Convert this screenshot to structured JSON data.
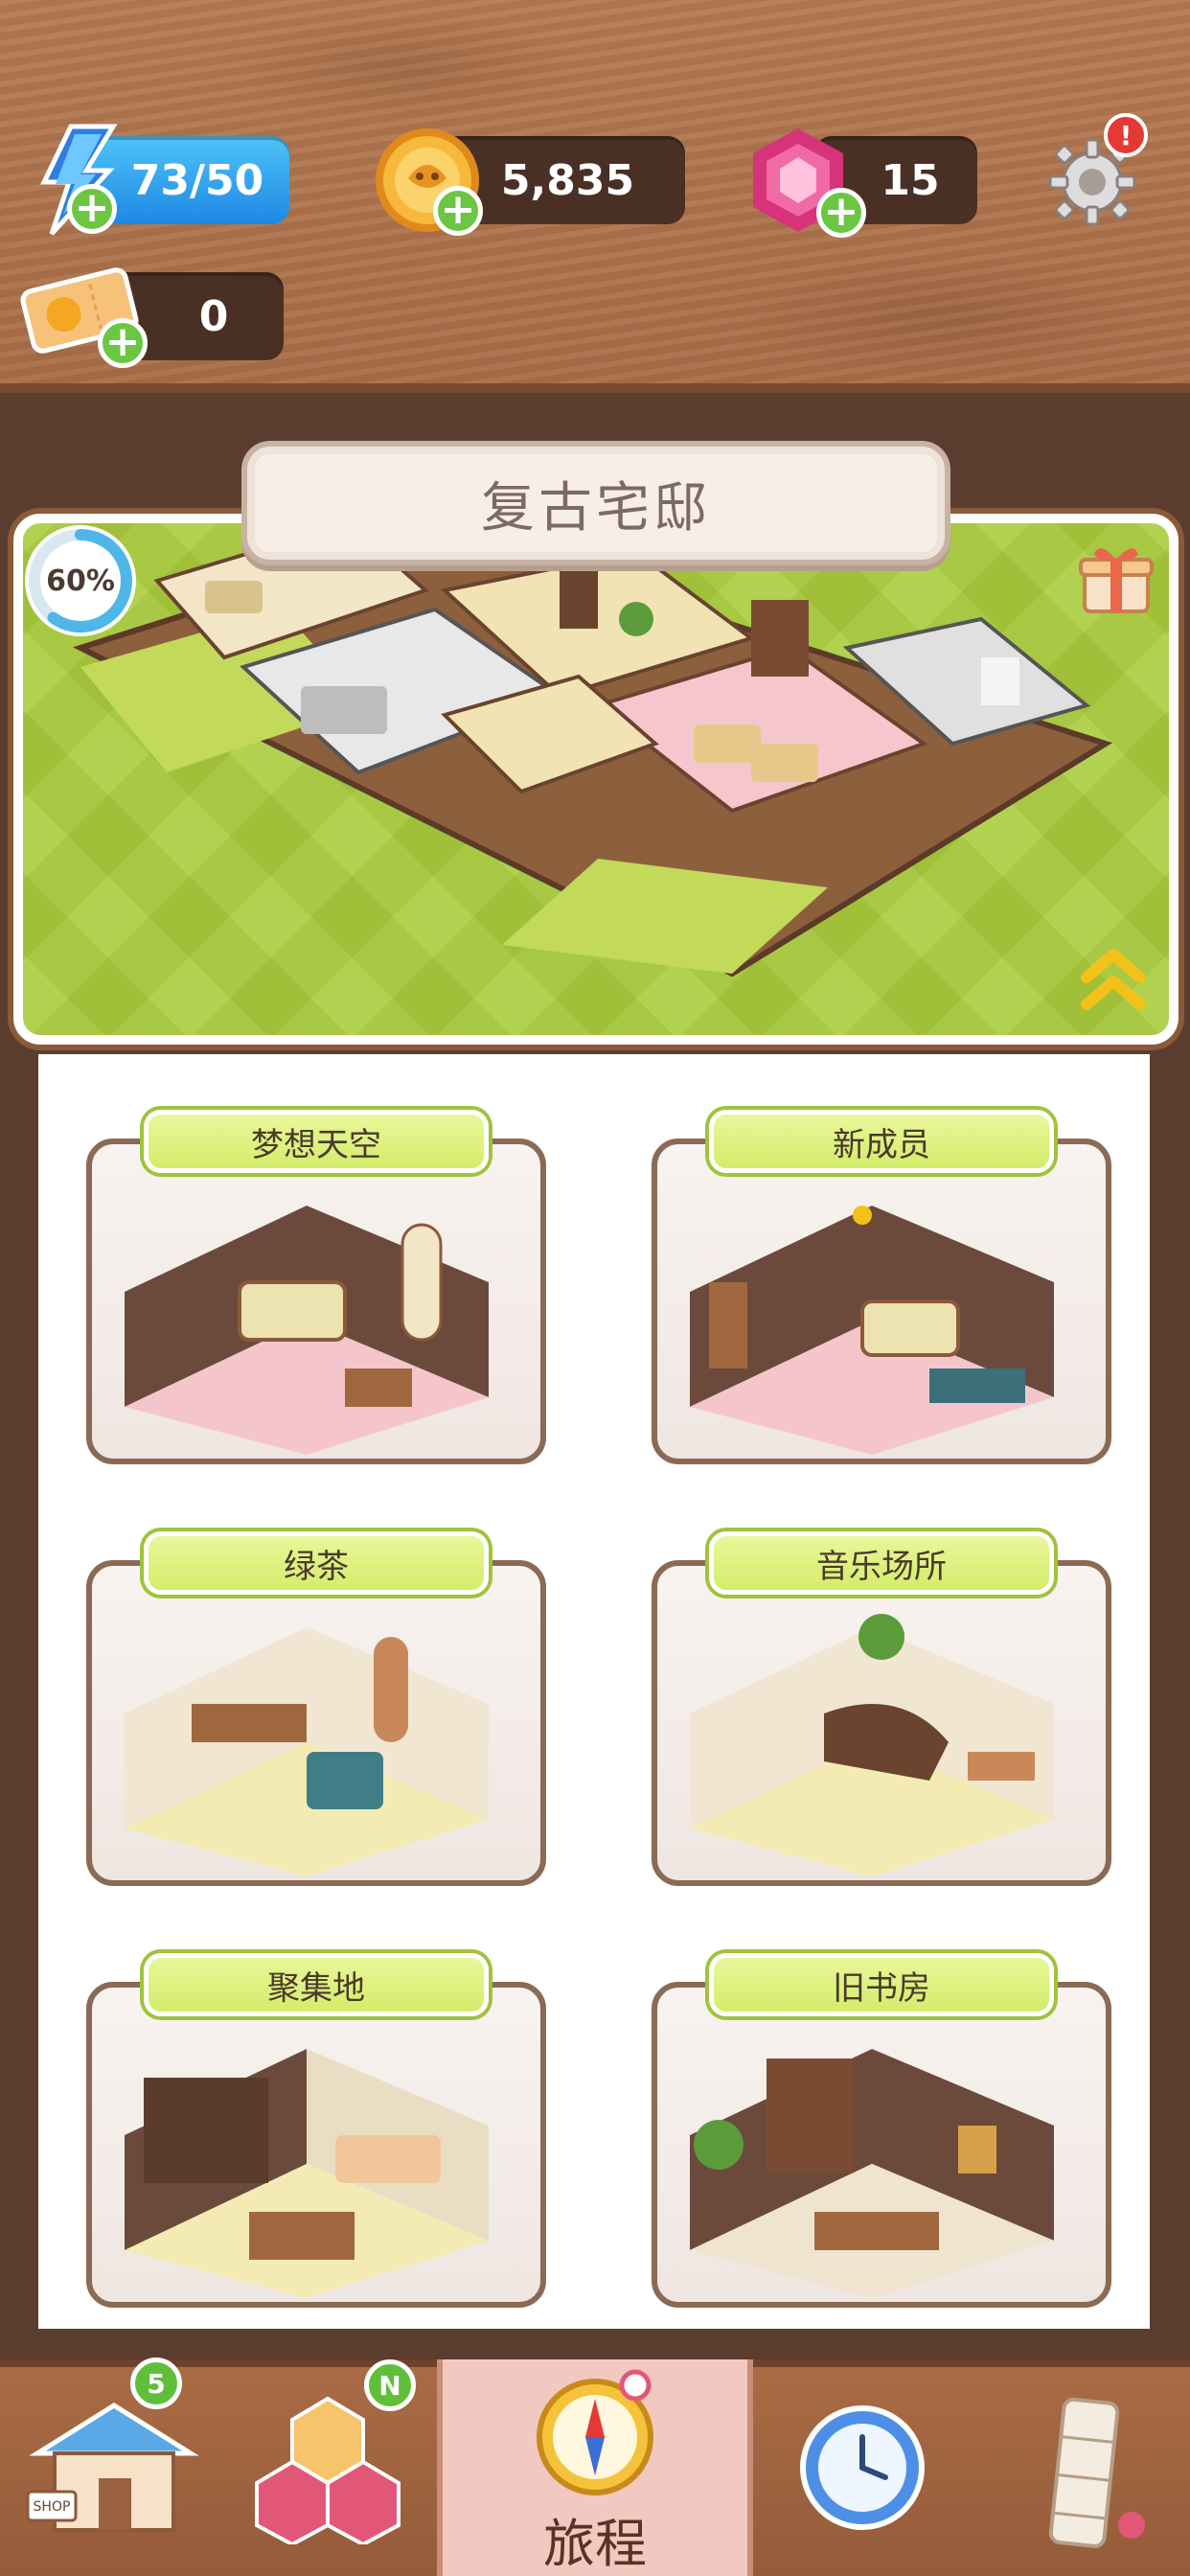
{
  "currencies": {
    "energy": "73/50",
    "coins": "5,835",
    "gems": "15",
    "tickets": "0",
    "plus_symbol": "+"
  },
  "settings": {
    "icon": "gear-icon",
    "alert": "!"
  },
  "house": {
    "title": "复古宅邸",
    "progress_label": "60%",
    "progress": 0.6
  },
  "rooms": [
    {
      "name": "梦想天空"
    },
    {
      "name": "新成员"
    },
    {
      "name": "绿茶"
    },
    {
      "name": "音乐场所"
    },
    {
      "name": "聚集地"
    },
    {
      "name": "旧书房"
    }
  ],
  "nav": {
    "shop_badge": "5",
    "collection_badge": "N",
    "journey_label": "旅程",
    "shop_sign": "SHOP"
  },
  "colors": {
    "wood": "#a86d47",
    "grass": "#a9cc3c",
    "label_green": "#d4ec6a",
    "energy_blue": "#1e88e5",
    "active_tab": "#f2c9c0"
  }
}
